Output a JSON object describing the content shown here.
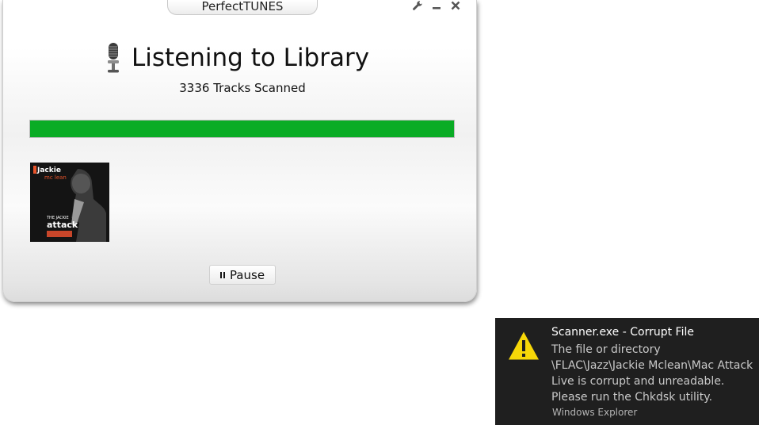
{
  "window": {
    "title": "PerfectTUNES",
    "controls": [
      "wrench-icon",
      "minimize-icon",
      "close-icon"
    ]
  },
  "main": {
    "heading": "Listening to Library",
    "tracks_scanned": "3336 Tracks Scanned",
    "progress": 1.0,
    "progress_color": "#0aac25",
    "pause_label": "Pause"
  },
  "cover": {
    "line1": "Jackie",
    "line2": "mc lean",
    "line3": "THE JACKIE",
    "line4": "attack"
  },
  "notification": {
    "title": "Scanner.exe - Corrupt File",
    "body": "The file or directory \\FLAC\\Jazz\\Jackie Mclean\\Mac Attack Live is corrupt and unreadable. Please run the Chkdsk utility.",
    "source": "Windows Explorer",
    "icon": "warning-icon",
    "icon_color": "#f7d708"
  }
}
